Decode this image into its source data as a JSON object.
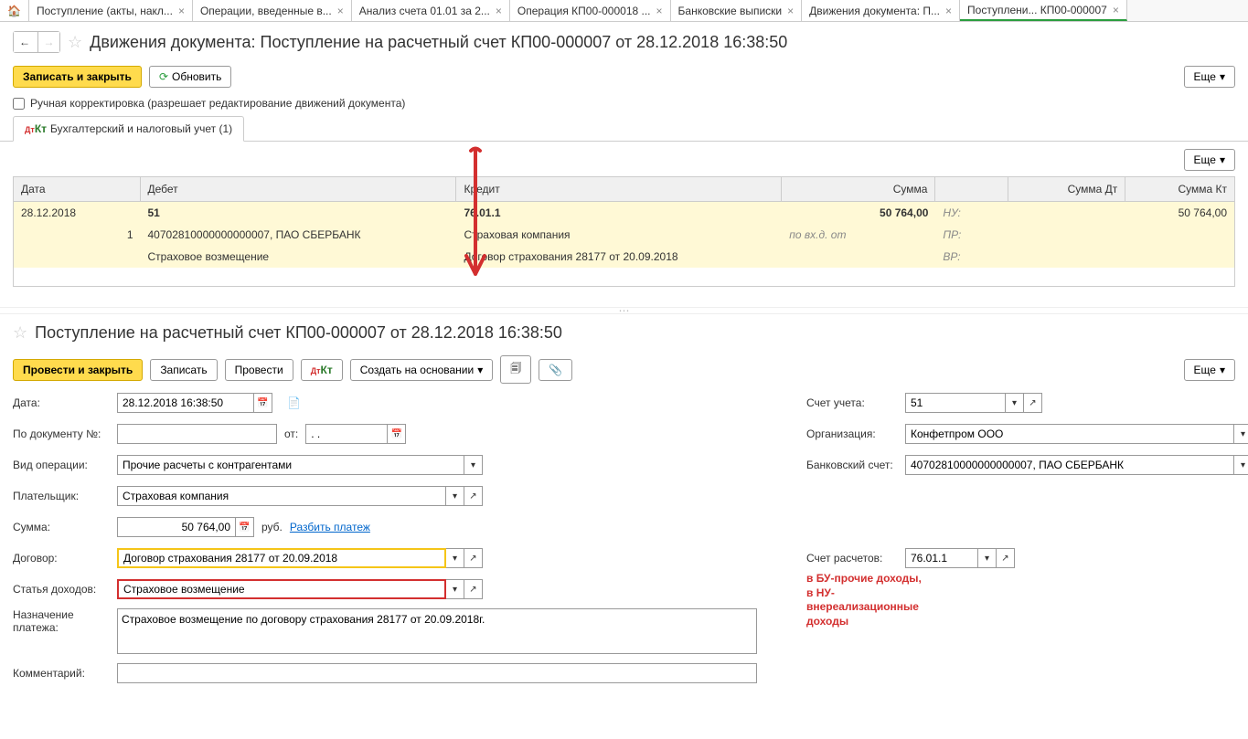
{
  "tabs": [
    {
      "label": "Поступление (акты, накл..."
    },
    {
      "label": "Операции, введенные в..."
    },
    {
      "label": "Анализ счета 01.01 за 2..."
    },
    {
      "label": "Операция КП00-000018 ..."
    },
    {
      "label": "Банковские выписки"
    },
    {
      "label": "Движения документа: П..."
    },
    {
      "label": "Поступлени... КП00-000007"
    }
  ],
  "top": {
    "title": "Движения документа: Поступление на расчетный счет КП00-000007 от 28.12.2018 16:38:50",
    "save_close": "Записать и закрыть",
    "refresh": "Обновить",
    "more": "Еще",
    "manual_edit": "Ручная корректировка (разрешает редактирование движений документа)",
    "subtab": "Бухгалтерский и налоговый учет (1)"
  },
  "table": {
    "headers": {
      "date": "Дата",
      "debit": "Дебет",
      "credit": "Кредит",
      "sum": "Сумма",
      "sumdt": "Сумма Дт",
      "sumkt": "Сумма Кт"
    },
    "r1": {
      "date": "28.12.2018",
      "debit": "51",
      "credit": "76.01.1",
      "sum": "50 764,00",
      "tag": "НУ:",
      "sumkt": "50 764,00"
    },
    "r2": {
      "num": "1",
      "debit": "40702810000000000007, ПАО СБЕРБАНК",
      "credit": "Страховая компания",
      "note": "по вх.д. от",
      "tag": "ПР:"
    },
    "r3": {
      "debit": "Страховое возмещение",
      "credit": "Договор страхования 28177 от 20.09.2018",
      "tag": "ВР:"
    }
  },
  "bottom": {
    "title": "Поступление на расчетный счет КП00-000007 от 28.12.2018 16:38:50",
    "post_close": "Провести и закрыть",
    "write": "Записать",
    "post": "Провести",
    "create_based": "Создать на основании",
    "more": "Еще"
  },
  "form": {
    "date_label": "Дата:",
    "date": "28.12.2018 16:38:50",
    "docnum_label": "По документу №:",
    "docnum": "",
    "from": "от:",
    "from_val": ". .",
    "optype_label": "Вид операции:",
    "optype": "Прочие расчеты с контрагентами",
    "payer_label": "Плательщик:",
    "payer": "Страховая компания",
    "sum_label": "Сумма:",
    "sum": "50 764,00",
    "rub": "руб.",
    "split": "Разбить платеж",
    "contract_label": "Договор:",
    "contract": "Договор страхования 28177 от 20.09.2018",
    "income_label": "Статья доходов:",
    "income": "Страховое возмещение",
    "purpose_label": "Назначение платежа:",
    "purpose": "Страховое возмещение по договору страхования 28177 от 20.09.2018г.",
    "comment_label": "Комментарий:",
    "comment": "",
    "account_label": "Счет учета:",
    "account": "51",
    "org_label": "Организация:",
    "org": "Конфетпром ООО",
    "bank_label": "Банковский счет:",
    "bank": "40702810000000000007, ПАО СБЕРБАНК",
    "settle_label": "Счет расчетов:",
    "settle": "76.01.1"
  },
  "annotation": {
    "l1": "в БУ-прочие доходы,",
    "l2": "в НУ-",
    "l3": "внереализационные",
    "l4": "доходы"
  }
}
